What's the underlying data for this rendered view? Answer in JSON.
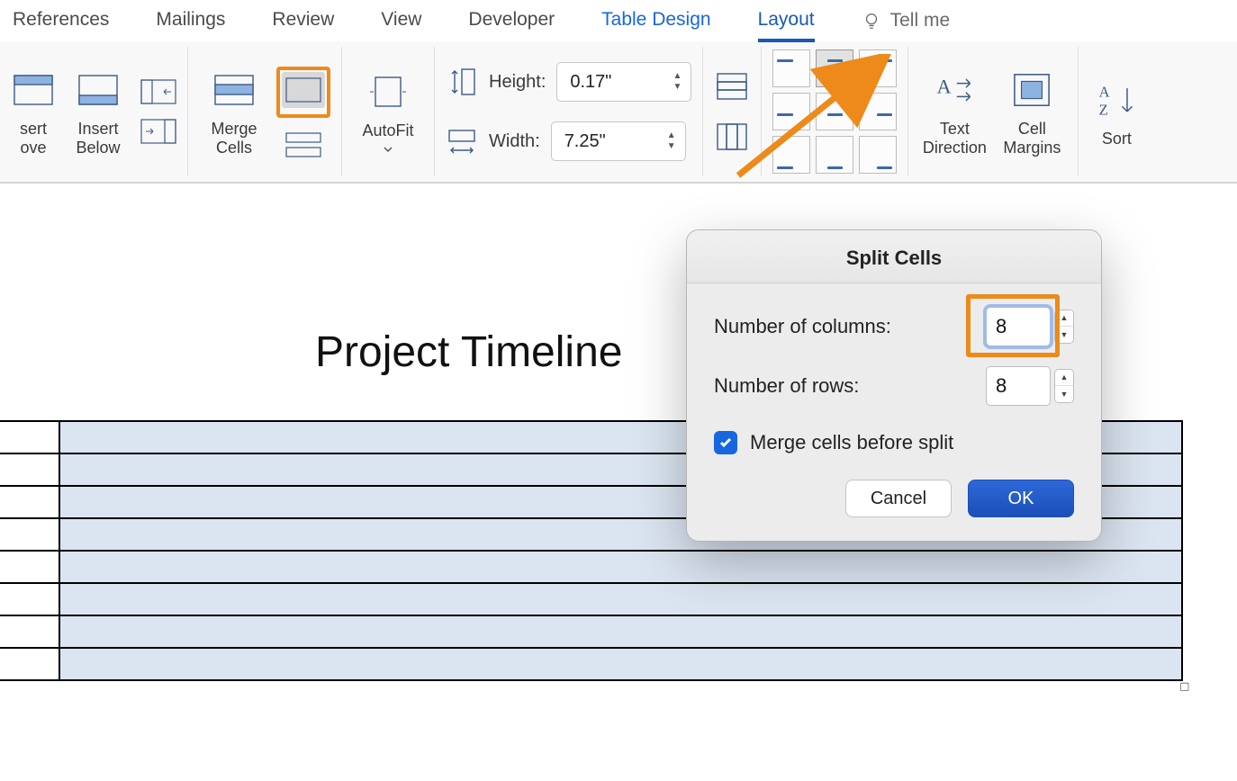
{
  "tabs": {
    "references": "References",
    "mailings": "Mailings",
    "review": "Review",
    "view": "View",
    "developer": "Developer",
    "table_design": "Table Design",
    "layout": "Layout",
    "tell_me": "Tell me"
  },
  "ribbon": {
    "insert_above": "sert\nove",
    "insert_below": "Insert\nBelow",
    "merge_cells": "Merge\nCells",
    "autofit": "AutoFit",
    "height_label": "Height:",
    "height_value": "0.17\"",
    "width_label": "Width:",
    "width_value": "7.25\"",
    "text_direction": "Text\nDirection",
    "cell_margins": "Cell\nMargins",
    "sort": "Sort"
  },
  "document": {
    "title": "Project Timeline"
  },
  "dialog": {
    "title": "Split Cells",
    "num_cols_label": "Number of columns:",
    "num_cols_value": "8",
    "num_rows_label": "Number of rows:",
    "num_rows_value": "8",
    "merge_before": "Merge cells before split",
    "cancel": "Cancel",
    "ok": "OK"
  }
}
